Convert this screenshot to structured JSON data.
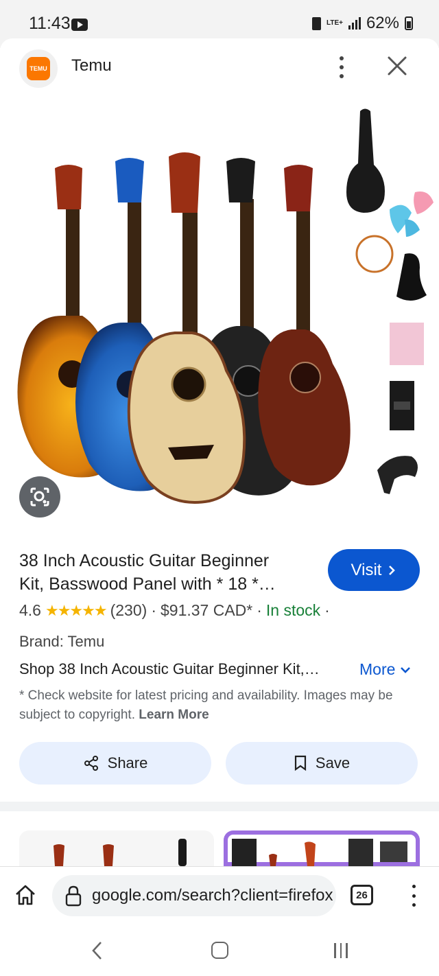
{
  "status_bar": {
    "time": "11:43",
    "network": "LTE+",
    "battery": "62%"
  },
  "sheet": {
    "site_name": "Temu",
    "favicon_text": "TEMU"
  },
  "product": {
    "title_line1": "38 Inch Acoustic Guitar Beginner",
    "title_line2": "Kit, Basswood Panel with * 18 *…",
    "visit_label": "Visit",
    "rating": "4.6",
    "stars": "★★★★★",
    "review_count": "(230)",
    "price": "$91.37 CAD*",
    "stock": "In stock",
    "brand": "Brand: Temu",
    "shop_text": "Shop 38 Inch Acoustic Guitar Beginner Kit,…",
    "more_label": "More",
    "disclaimer": "* Check website for latest pricing and availability. Images may be subject to copyright.",
    "learn_more": "Learn More"
  },
  "actions": {
    "share_label": "Share",
    "save_label": "Save"
  },
  "browser": {
    "url": "google.com/search?client=firefox",
    "tab_count": "26"
  },
  "colors": {
    "accent": "#0b57d0",
    "stock_green": "#188038",
    "star_gold": "#f5b400",
    "pill_bg": "#e8f0fe",
    "temu_orange": "#fb7701"
  }
}
